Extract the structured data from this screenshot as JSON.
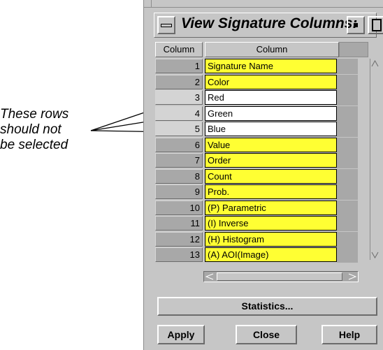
{
  "annotation": {
    "lines": [
      "These rows",
      "should not",
      "be selected"
    ]
  },
  "window": {
    "title": "View Signature Columns:",
    "menu_icon": "window-menu-icon",
    "minimize_icon": "minimize-icon",
    "maximize_icon": "maximize-icon"
  },
  "table": {
    "headers": [
      "Column",
      "Column"
    ],
    "rows": [
      {
        "num": "1",
        "name": "Signature Name",
        "selected": true
      },
      {
        "num": "2",
        "name": "Color",
        "selected": true
      },
      {
        "num": "3",
        "name": "Red",
        "selected": false
      },
      {
        "num": "4",
        "name": "Green",
        "selected": false
      },
      {
        "num": "5",
        "name": "Blue",
        "selected": false
      },
      {
        "num": "6",
        "name": "Value",
        "selected": true
      },
      {
        "num": "7",
        "name": "Order",
        "selected": true
      },
      {
        "num": "8",
        "name": "Count",
        "selected": true
      },
      {
        "num": "9",
        "name": "Prob.",
        "selected": true
      },
      {
        "num": "10",
        "name": "(P) Parametric",
        "selected": true
      },
      {
        "num": "11",
        "name": "(I) Inverse",
        "selected": true
      },
      {
        "num": "12",
        "name": "(H) Histogram",
        "selected": true
      },
      {
        "num": "13",
        "name": "(A) AOI(Image)",
        "selected": true
      }
    ]
  },
  "buttons": {
    "statistics": "Statistics...",
    "apply": "Apply",
    "close": "Close",
    "help": "Help"
  },
  "colors": {
    "selected": "#ffff33",
    "unselected": "#ffffff",
    "window_bg": "#c6c6c6"
  }
}
